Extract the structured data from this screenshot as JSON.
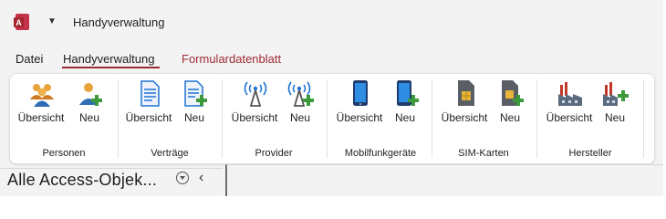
{
  "window": {
    "title": "Handyverwaltung",
    "app_icon": "access-app-icon",
    "qat_icon": "customize-quick-access-chevron-icon"
  },
  "tabs": [
    {
      "label": "Datei"
    },
    {
      "label": "Handyverwaltung",
      "active": true
    },
    {
      "label": "Formulardatenblatt",
      "contextual": true
    }
  ],
  "ribbon": {
    "groups": [
      {
        "label": "Personen",
        "buttons": [
          {
            "label": "Übersicht",
            "icon": "people-icon"
          },
          {
            "label": "Neu",
            "icon": "person-add-icon"
          }
        ]
      },
      {
        "label": "Verträge",
        "buttons": [
          {
            "label": "Übersicht",
            "icon": "document-icon"
          },
          {
            "label": "Neu",
            "icon": "document-add-icon"
          }
        ]
      },
      {
        "label": "Provider",
        "buttons": [
          {
            "label": "Übersicht",
            "icon": "antenna-icon"
          },
          {
            "label": "Neu",
            "icon": "antenna-add-icon"
          }
        ]
      },
      {
        "label": "Mobilfunkgeräte",
        "buttons": [
          {
            "label": "Übersicht",
            "icon": "smartphone-icon"
          },
          {
            "label": "Neu",
            "icon": "smartphone-add-icon"
          }
        ]
      },
      {
        "label": "SIM-Karten",
        "buttons": [
          {
            "label": "Übersicht",
            "icon": "sim-card-icon"
          },
          {
            "label": "Neu",
            "icon": "sim-card-add-icon"
          }
        ]
      },
      {
        "label": "Hersteller",
        "buttons": [
          {
            "label": "Übersicht",
            "icon": "factory-icon"
          },
          {
            "label": "Neu",
            "icon": "factory-add-icon"
          }
        ]
      }
    ]
  },
  "nav_pane": {
    "title": "Alle Access-Objek...",
    "dropdown_icon": "chevron-down-circle-icon",
    "collapse_icon": "chevron-left-icon"
  },
  "colors": {
    "accent": "#9e2b33",
    "add_green": "#3c9a3c",
    "blue": "#1e73d1"
  }
}
